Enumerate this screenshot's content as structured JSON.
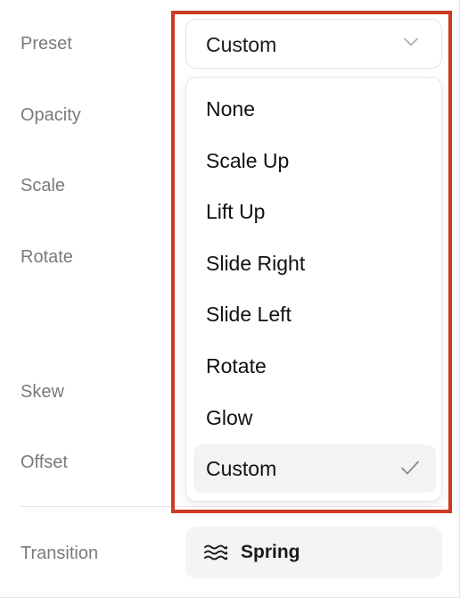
{
  "labels": {
    "preset": "Preset",
    "opacity": "Opacity",
    "scale": "Scale",
    "rotate": "Rotate",
    "skew": "Skew",
    "offset": "Offset",
    "transition": "Transition"
  },
  "preset_select": {
    "value": "Custom",
    "chevron_icon": "chevron-down-icon"
  },
  "dropdown": {
    "options": [
      {
        "label": "None"
      },
      {
        "label": "Scale Up"
      },
      {
        "label": "Lift Up"
      },
      {
        "label": "Slide Right"
      },
      {
        "label": "Slide Left"
      },
      {
        "label": "Rotate"
      },
      {
        "label": "Glow"
      },
      {
        "label": "Custom",
        "selected": true
      }
    ],
    "selected_icon": "check-icon"
  },
  "transition_button": {
    "label": "Spring",
    "icon": "spring-icon"
  },
  "colors": {
    "highlight_frame": "#cc3a22",
    "label_text": "#7a7a7a",
    "selected_option_bg": "#f3f3f3"
  }
}
